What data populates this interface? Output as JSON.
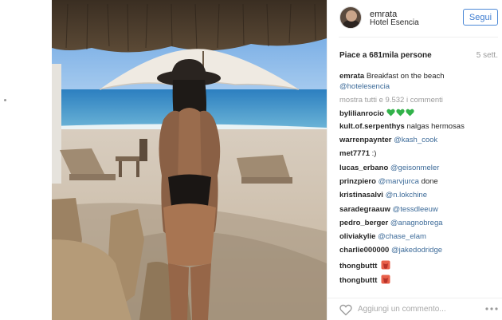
{
  "post": {
    "username": "emrata",
    "location": "Hotel Esencia",
    "follow_label": "Segui",
    "likes_text": "Piace a 681mila persone",
    "time": "5 sett.",
    "caption_user": "emrata",
    "caption_text": "Breakfast on the beach",
    "caption_mention": "@hotelesencia",
    "show_all_comments": "mostra tutti e 9.532 i commenti",
    "comment_placeholder": "Aggiungi un commento...",
    "photo_alt": "Beach photo",
    "colors": {
      "follow_blue": "#3d7cd1",
      "mention_blue": "#3d6b99",
      "heart_green": "#32b24a",
      "heart_red": "#d9573a"
    }
  },
  "comments": [
    {
      "user": "bylilianrocio",
      "text": "",
      "mention": "",
      "icons": [
        "green-heart",
        "green-heart",
        "green-heart"
      ]
    },
    {
      "user": "kult.of.serpenthys",
      "text": "nalgas hermosas",
      "mention": "",
      "icons": []
    },
    {
      "user": "warrenpaynter",
      "text": "",
      "mention": "@kash_cook",
      "icons": []
    },
    {
      "user": "met7771",
      "text": ":)",
      "mention": "",
      "icons": []
    },
    {
      "user": "lucas_erbano",
      "text": "",
      "mention": "@geisonmeler",
      "icons": []
    },
    {
      "user": "prinzpiero",
      "text": "",
      "mention": "@marvjurca",
      "tail": "done",
      "icons": []
    },
    {
      "user": "kristinasalvi",
      "text": "",
      "mention": "@n.lokchine",
      "icons": []
    },
    {
      "user": "saradegraauw",
      "text": "",
      "mention": "@tessdleeuw",
      "icons": []
    },
    {
      "user": "pedro_berger",
      "text": "",
      "mention": "@anagnobrega",
      "icons": []
    },
    {
      "user": "oliviakylie",
      "text": "",
      "mention": "@chase_elam",
      "icons": []
    },
    {
      "user": "charlie000000",
      "text": "",
      "mention": "@jakedodridge",
      "icons": []
    },
    {
      "user": "thongbuttt",
      "text": "",
      "mention": "",
      "icons": [
        "tongue-emoji"
      ]
    },
    {
      "user": "thongbuttt",
      "text": "",
      "mention": "",
      "icons": [
        "tongue-emoji"
      ]
    }
  ]
}
